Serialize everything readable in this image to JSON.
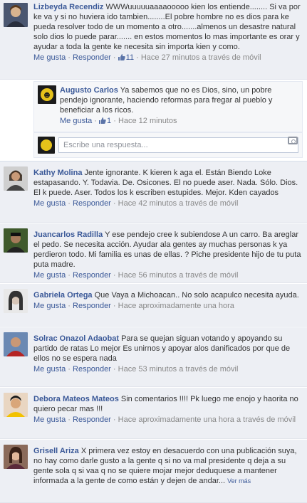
{
  "actions": {
    "like": "Me gusta",
    "reply": "Responder",
    "more": "Ver más"
  },
  "reply_placeholder": "Escribe una respuesta...",
  "colors": {
    "link": "#3b5998",
    "underline": "#d21f2b",
    "background": "#edeff4"
  },
  "comments": [
    {
      "author": "Lizbeyda Recendiz",
      "text": "WWWuuuuuaaaaooooo kien los entiende........ Si va por ke va y si no huviera ido tambien........El pobre hombre no es dios para ke pueda resolver todo de un momento a otro.......almenos un desastre natural solo dios lo puede parar....... en estos momentos lo mas importante es orar y ayudar a toda la gente ke necesita sin importa kien y como.",
      "likes": "11",
      "time": "Hace 27 minutos a través de móvil"
    },
    {
      "author": "Augusto Carlos",
      "text": "Ya sabemos que no es Dios, sino, un pobre pendejo ignorante, haciendo reformas para fregar al pueblo y beneficiar a los ricos.",
      "likes": "1",
      "time": "Hace 12 minutos"
    },
    {
      "author": "Kathy Molina",
      "text": "Jente ignorante. K kieren k aga el. Están Biendo Loke estapasando. Y. Todavia. De. Osicones. El no puede aser. Nada. Sólo. Dios. El k puede. Aser. Todos los k escriben estupides. Mejor. Kden cayados",
      "time": "Hace 42 minutos a través de móvil"
    },
    {
      "author": "Juancarlos Radilla",
      "text": "Y ese pendejo cree k subiendose A un carro. Ba areglar el pedo. Se necesita acción. Ayudar ala gentes ay muchas personas k ya perdieron todo. Mi familia es unas de ellas. ? Piche presidente hijo de tu puta puta madre.",
      "time": "Hace 56 minutos a través de móvil"
    },
    {
      "author": "Gabriela Ortega",
      "text": "Que Vaya a Michoacan.. No solo acapulco necesita ayuda.",
      "time": "Hace aproximadamente una hora"
    },
    {
      "author": "Solrac Onazol Adaobat",
      "text": "Para se quejan siguan votando y apoyando su partido de ratas Lo mejor Es unirnos y apoyar alos danificados por que de ellos no se espera nada",
      "time": "Hace 53 minutos a través de móvil"
    },
    {
      "author": "Debora Mateos Mateos",
      "text": "Sin comentarios !!!! Pk luego me enojo y haorita no quiero pecar mas !!!",
      "time": "Hace aproximadamente una hora a través de móvil"
    },
    {
      "author": "Grisell Ariza",
      "text": "X primera vez estoy en desacuerdo con una publicación suya, no hay como darle gusto a la gente q si no va mal presidente q deja a su gente sola q si vaa q no se quiere mojar mejor deduquese a mantener informada a la gente de como están y dejen de andar..."
    }
  ]
}
